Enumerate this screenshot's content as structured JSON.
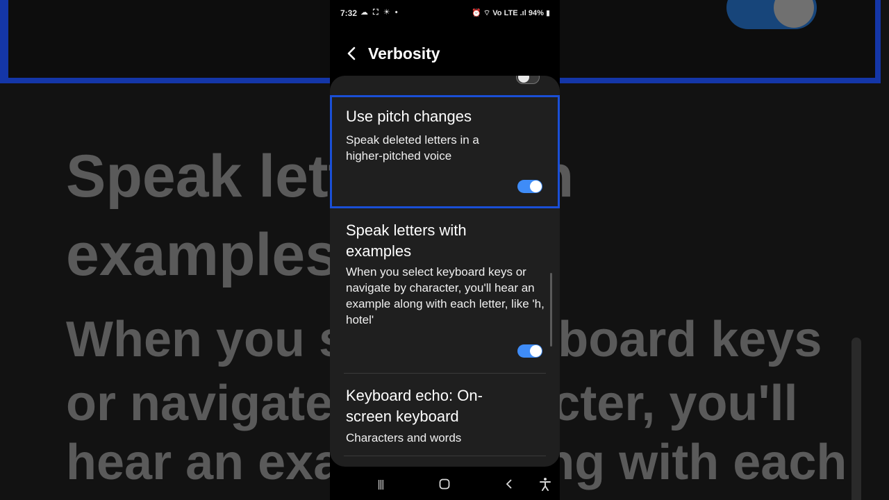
{
  "status_bar": {
    "time": "7:32",
    "left_icons": "☁ ⛶ ☀ •",
    "right_icons": "⏰ ⌔ Vo LTE .ıl",
    "battery": "94%"
  },
  "header": {
    "title": "Verbosity",
    "back_icon": "chevron-left-icon"
  },
  "settings": [
    {
      "title": "Use pitch changes",
      "subtitle": "Speak deleted letters in a higher-pitched voice",
      "toggle_on": true,
      "focused": true
    },
    {
      "title": "Speak letters with examples",
      "subtitle": "When you select keyboard keys or navigate by character, you'll hear an example along with each letter, like 'h, hotel'",
      "toggle_on": true,
      "focused": false
    },
    {
      "title": "Keyboard echo: On-screen keyboard",
      "subtitle": "Characters and words",
      "focused": false
    }
  ],
  "nav_bar": {
    "recents": "|||",
    "home": "▢",
    "back": "‹",
    "accessibility": "accessibility-icon"
  },
  "colors": {
    "accent": "#3f8cf7",
    "focus_border": "#1a4fd6",
    "card_bg": "#1f1f1f"
  }
}
